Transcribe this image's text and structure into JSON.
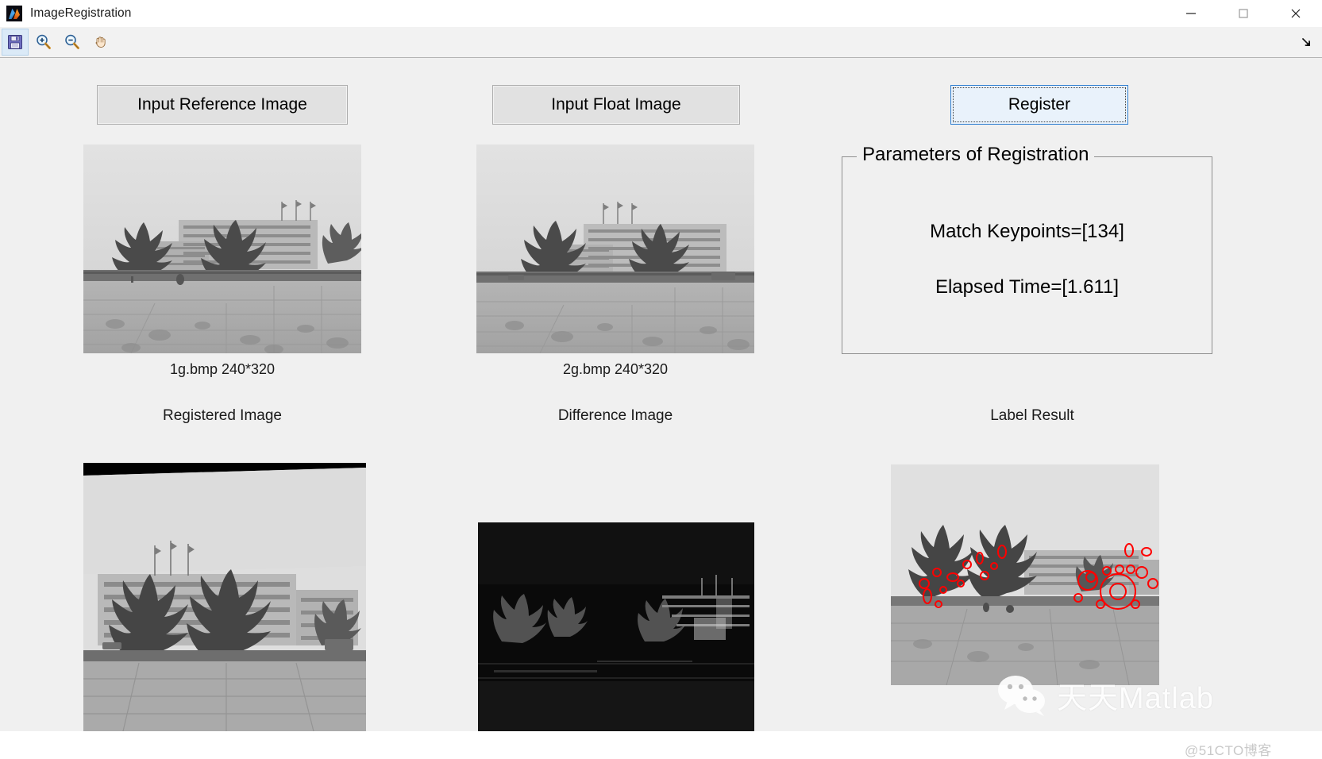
{
  "window": {
    "title": "ImageRegistration",
    "app_icon": "matlab-icon",
    "controls": {
      "minimize": "minimize-icon",
      "maximize": "maximize-icon",
      "close": "close-icon"
    }
  },
  "toolbar": {
    "items": [
      {
        "icon": "save-icon",
        "selected": true
      },
      {
        "icon": "zoom-in-icon",
        "selected": false
      },
      {
        "icon": "zoom-out-icon",
        "selected": false
      },
      {
        "icon": "pan-hand-icon",
        "selected": false
      }
    ],
    "overflow_icon": "overflow-arrow-icon"
  },
  "buttons": {
    "input_reference": "Input Reference Image",
    "input_float": "Input Float Image",
    "register": "Register"
  },
  "parameters_group": {
    "legend": "Parameters of Registration",
    "match_keypoints": "Match Keypoints=[134]",
    "elapsed_time": "Elapsed Time=[1.611]"
  },
  "captions": {
    "reference_image": "1g.bmp 240*320",
    "float_image": "2g.bmp 240*320"
  },
  "section_labels": {
    "registered": "Registered Image",
    "difference": "Difference Image",
    "label_result": "Label Result"
  },
  "watermarks": {
    "wechat": "天天Matlab",
    "site": "@51CTO博客"
  },
  "colors": {
    "accent_blue": "#2f7fd0",
    "button_face": "#e1e1e1",
    "panel_background": "#f0f0f0",
    "keypoint_marker": "#ff0000"
  }
}
